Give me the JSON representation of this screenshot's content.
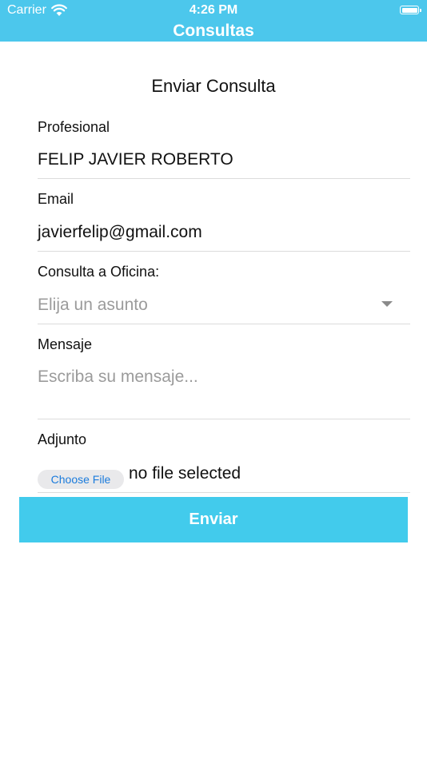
{
  "status_bar": {
    "carrier": "Carrier",
    "time": "4:26 PM"
  },
  "header": {
    "title": "Consultas"
  },
  "form": {
    "title": "Enviar Consulta",
    "profesional": {
      "label": "Profesional",
      "value": "FELIP JAVIER ROBERTO"
    },
    "email": {
      "label": "Email",
      "value": "javierfelip@gmail.com"
    },
    "oficina": {
      "label": "Consulta a Oficina:",
      "placeholder": "Elija un asunto"
    },
    "mensaje": {
      "label": "Mensaje",
      "placeholder": "Escriba su mensaje..."
    },
    "adjunto": {
      "label": "Adjunto",
      "button_label": "Choose File",
      "status": "no file selected"
    },
    "submit_label": "Enviar"
  },
  "colors": {
    "header_bg": "#4cc7ec",
    "submit_bg": "#42cbec",
    "link_blue": "#1a7bdc"
  },
  "icons": {
    "wifi": "wifi-icon",
    "battery": "battery-icon",
    "dropdown": "chevron-down-icon"
  }
}
